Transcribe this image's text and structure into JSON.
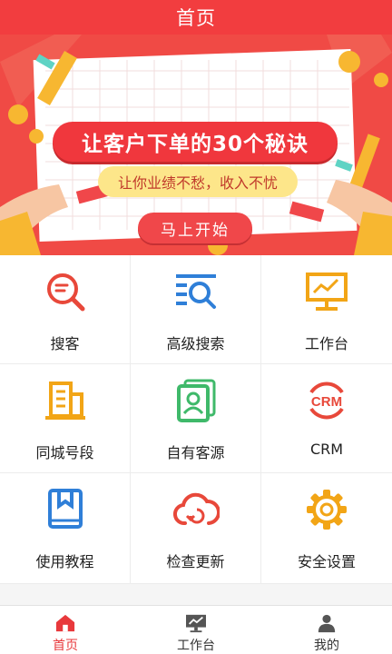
{
  "header": {
    "title": "首页"
  },
  "banner": {
    "headline": "让客户下单的30个秘诀",
    "subtitle": "让你业绩不愁，收入不忧",
    "cta_label": "马上开始"
  },
  "grid": {
    "items": [
      {
        "label": "搜客",
        "icon": "search-customer-icon",
        "color": "#e8483a"
      },
      {
        "label": "高级搜索",
        "icon": "advanced-search-icon",
        "color": "#2f7fd8"
      },
      {
        "label": "工作台",
        "icon": "workbench-monitor-icon",
        "color": "#f2a516"
      },
      {
        "label": "同城号段",
        "icon": "building-icon",
        "color": "#f2a516"
      },
      {
        "label": "自有客源",
        "icon": "contacts-icon",
        "color": "#3fb96a"
      },
      {
        "label": "CRM",
        "icon": "crm-icon",
        "color": "#e8483a"
      },
      {
        "label": "使用教程",
        "icon": "bookmark-book-icon",
        "color": "#2f7fd8"
      },
      {
        "label": "检查更新",
        "icon": "cloud-refresh-icon",
        "color": "#e8483a"
      },
      {
        "label": "安全设置",
        "icon": "gear-icon",
        "color": "#f2a516"
      }
    ]
  },
  "bottom_nav": {
    "items": [
      {
        "label": "首页",
        "icon": "home-icon",
        "active": true
      },
      {
        "label": "工作台",
        "icon": "workbench-icon",
        "active": false
      },
      {
        "label": "我的",
        "icon": "user-icon",
        "active": false
      }
    ]
  },
  "colors": {
    "brand_red": "#f23d3f",
    "active_tab": "#e8393c"
  }
}
